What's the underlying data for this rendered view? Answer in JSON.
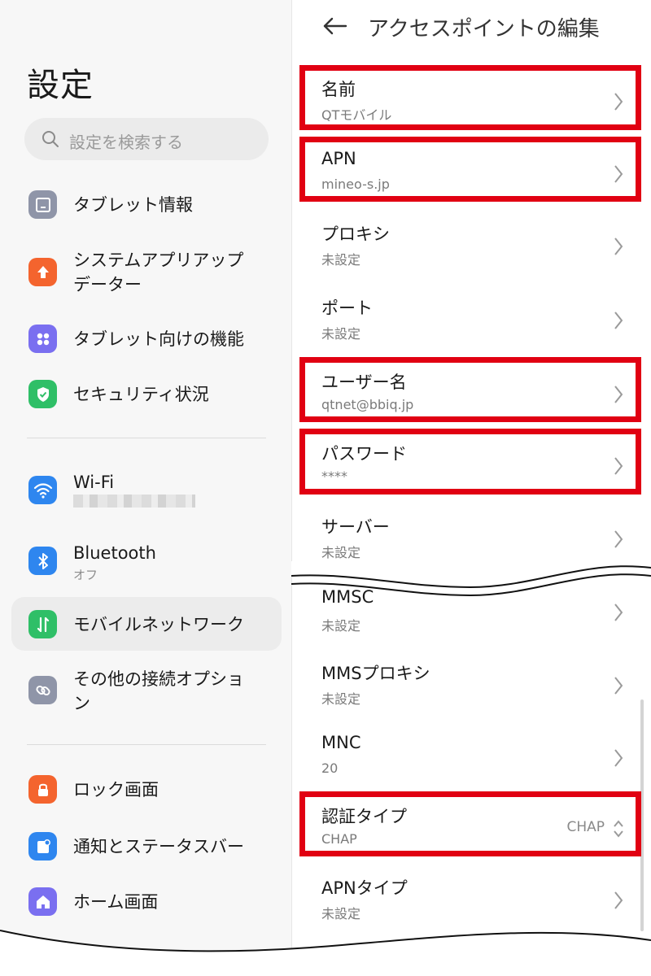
{
  "left": {
    "title": "設定",
    "search_placeholder": "設定を検索する",
    "items": [
      {
        "label": "タブレット情報",
        "color": "#8f95a8",
        "icon": "tablet-icon"
      },
      {
        "label": "システムアプリアップ",
        "label2": "データー",
        "color": "#f4642e",
        "icon": "upload-arrow-icon"
      },
      {
        "label": "タブレット向けの機能",
        "color": "#7a6ff0",
        "icon": "grid-dots-icon"
      },
      {
        "label": "セキュリティ状況",
        "color": "#2fbf67",
        "icon": "shield-check-icon"
      },
      {
        "label": "Wi-Fi",
        "color": "#2e86ef",
        "icon": "wifi-icon"
      },
      {
        "label": "Bluetooth",
        "sub": "オフ",
        "color": "#2e86ef",
        "icon": "bluetooth-icon"
      },
      {
        "label": "モバイルネットワーク",
        "color": "#2fbf67",
        "icon": "mobile-data-icon"
      },
      {
        "label": "その他の接続オプショ",
        "label2": "ン",
        "color": "#8f95a8",
        "icon": "link-icon"
      },
      {
        "label": "ロック画面",
        "color": "#f4642e",
        "icon": "lock-icon"
      },
      {
        "label": "通知とステータスバー",
        "color": "#2e86ef",
        "icon": "notification-icon"
      },
      {
        "label": "ホーム画面",
        "color": "#7a6ff0",
        "icon": "home-icon"
      }
    ]
  },
  "right": {
    "title": "アクセスポイントの編集",
    "rows": [
      {
        "title": "名前",
        "value": "QTモバイル"
      },
      {
        "title": "APN",
        "value": "mineo-s.jp"
      },
      {
        "title": "プロキシ",
        "value": "未設定"
      },
      {
        "title": "ポート",
        "value": "未設定"
      },
      {
        "title": "ユーザー名",
        "value": "qtnet@bbiq.jp"
      },
      {
        "title": "パスワード",
        "value": "****"
      },
      {
        "title": "サーバー",
        "value": "未設定"
      },
      {
        "title": "MMSC",
        "value": "未設定"
      },
      {
        "title": "MMSプロキシ",
        "value": "未設定"
      },
      {
        "title": "MNC",
        "value": "20"
      },
      {
        "title": "認証タイプ",
        "value": "CHAP",
        "selector": "CHAP"
      },
      {
        "title": "APNタイプ",
        "value": "未設定"
      }
    ]
  },
  "colors": {
    "highlight": "#e10012",
    "accent": "#2fbf67"
  }
}
